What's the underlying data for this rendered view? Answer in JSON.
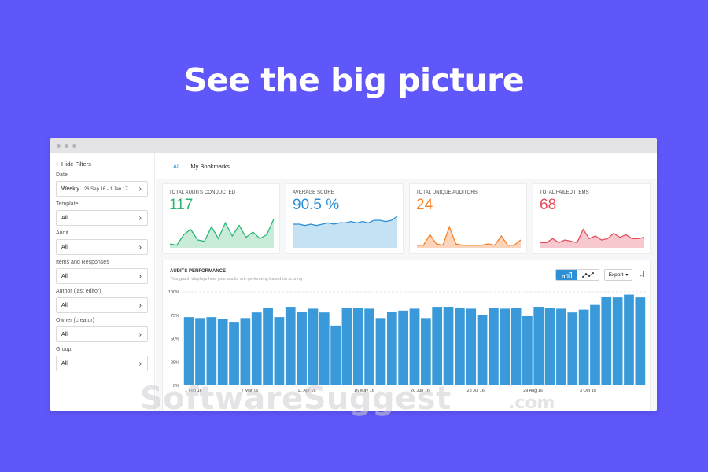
{
  "headline": "See the big picture",
  "colors": {
    "background": "#5f57fa",
    "accent": "#2d8fd5",
    "green": "#2bb673",
    "blue": "#2d8fd5",
    "orange": "#f5822a",
    "red": "#e84c5b",
    "bar": "#3a9ad9"
  },
  "sidebar": {
    "hide_filters": "Hide Filters",
    "filters": [
      {
        "label": "Date",
        "value": "Weekly",
        "range": "26 Sep 16 - 1 Jan 17"
      },
      {
        "label": "Template",
        "value": "All"
      },
      {
        "label": "Audit",
        "value": "All"
      },
      {
        "label": "Items and Responses",
        "value": "All"
      },
      {
        "label": "Author (last editor)",
        "value": "All"
      },
      {
        "label": "Owner (creator)",
        "value": "All"
      },
      {
        "label": "Group",
        "value": "All"
      }
    ]
  },
  "tabs": [
    {
      "label": "All",
      "active": true
    },
    {
      "label": "My Bookmarks",
      "active": false
    }
  ],
  "cards": [
    {
      "title": "TOTAL AUDITS CONDUCTED",
      "value": "117",
      "color": "#2bb673",
      "fill": "#c9ecd9",
      "spark": [
        3,
        2,
        10,
        14,
        6,
        5,
        16,
        7,
        19,
        9,
        17,
        8,
        12,
        7,
        10,
        22
      ]
    },
    {
      "title": "AVERAGE SCORE",
      "value": "90.5 %",
      "color": "#2d8fd5",
      "fill": "#c5e2f5",
      "spark": [
        18,
        18,
        17,
        18,
        17,
        18,
        19,
        18,
        19,
        19,
        20,
        19,
        20,
        19,
        21,
        21,
        20,
        21,
        24
      ]
    },
    {
      "title": "TOTAL UNIQUE AUDITORS",
      "value": "24",
      "color": "#f5822a",
      "fill": "#fbd4bb",
      "spark": [
        2,
        2,
        10,
        3,
        2,
        16,
        3,
        2,
        2,
        2,
        2,
        3,
        2,
        9,
        2,
        2,
        6
      ]
    },
    {
      "title": "TOTAL FAILED ITEMS",
      "value": "68",
      "color": "#e84c5b",
      "fill": "#f7c9cf",
      "spark": [
        4,
        4,
        7,
        4,
        6,
        5,
        4,
        14,
        7,
        9,
        6,
        7,
        11,
        8,
        10,
        7,
        7,
        8
      ]
    }
  ],
  "performance": {
    "title": "AUDITS PERFORMANCE",
    "subtitle": "This graph displays how your audits are performing based on scoring",
    "export_label": "Export",
    "view_bar_icon": "bar-chart-icon",
    "view_line_icon": "line-chart-icon"
  },
  "chart_data": {
    "type": "bar",
    "ylim": [
      0,
      100
    ],
    "yticks": [
      "0%",
      "25%",
      "50%",
      "75%",
      "100%"
    ],
    "xticks": [
      {
        "index": 0,
        "label": "1 Feb 16"
      },
      {
        "index": 5,
        "label": "7 Mar 16"
      },
      {
        "index": 10,
        "label": "11 Apr 16"
      },
      {
        "index": 15,
        "label": "16 May 16"
      },
      {
        "index": 20,
        "label": "20 Jun 16"
      },
      {
        "index": 25,
        "label": "25 Jul 16"
      },
      {
        "index": 30,
        "label": "29 Aug 16"
      },
      {
        "index": 35,
        "label": "3 Oct 16"
      }
    ],
    "values": [
      73,
      72,
      73,
      71,
      68,
      72,
      78,
      83,
      73,
      84,
      79,
      82,
      78,
      64,
      83,
      83,
      82,
      72,
      79,
      80,
      82,
      72,
      84,
      84,
      83,
      82,
      75,
      83,
      82,
      83,
      74,
      84,
      83,
      82,
      78,
      81,
      86,
      95,
      94,
      97,
      94
    ]
  },
  "watermark": {
    "text": "SoftwareSuggest",
    "suffix": ".com"
  }
}
